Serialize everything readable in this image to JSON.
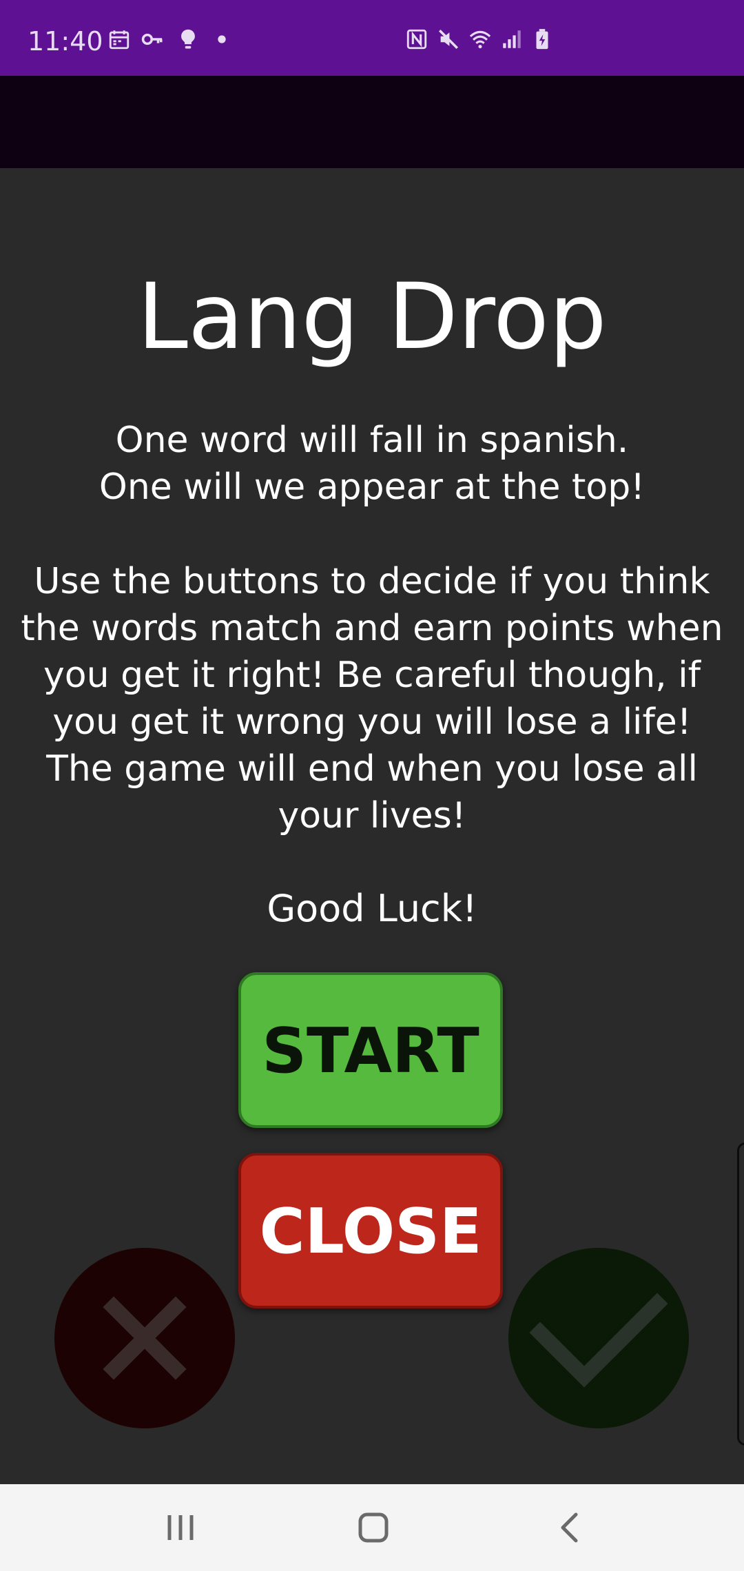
{
  "status_bar": {
    "time": "11:40",
    "left_icons": [
      "calendar-icon",
      "vpn-key-icon",
      "lightbulb-icon",
      "dot-icon"
    ],
    "right_icons": [
      "nfc-icon",
      "mute-icon",
      "wifi-icon",
      "signal-icon",
      "battery-charging-icon"
    ],
    "background_color": "#5e1293"
  },
  "app_bar": {
    "background_color": "#0e0212"
  },
  "main": {
    "title": "Lang Drop",
    "intro_line_1": "One word will fall in spanish.",
    "intro_line_2": "One will we appear at the top!",
    "rules_text": "Use the buttons to decide if you think the words match and earn points when you get it right! Be careful though, if you get it wrong you will lose a life! The game will end when you lose all your lives!",
    "good_luck": "Good Luck!"
  },
  "buttons": {
    "start_label": "START",
    "close_label": "CLOSE",
    "start_color": "#56ba3e",
    "close_color": "#bd261b"
  },
  "answer_buttons": {
    "wrong_icon": "close-x-icon",
    "right_icon": "checkmark-icon"
  },
  "nav_bar": {
    "icons": [
      "recent-apps-icon",
      "home-icon",
      "back-icon"
    ]
  }
}
